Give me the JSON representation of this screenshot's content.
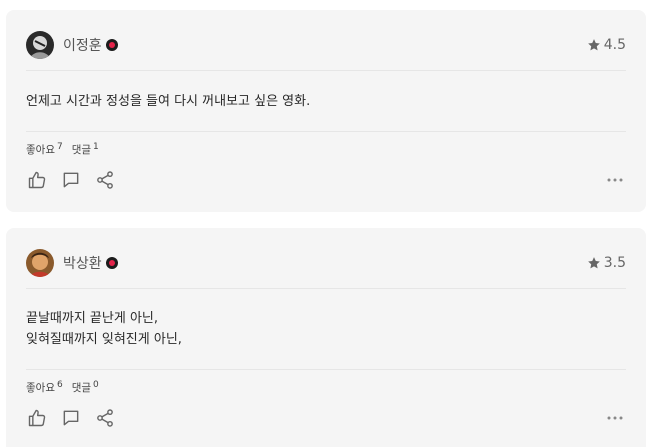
{
  "reviews": [
    {
      "author": "이정훈",
      "rating": "4.5",
      "text": "언제고 시간과 정성을 들여 다시 꺼내보고 싶은 영화.",
      "likes_label": "좋아요",
      "likes_count": "7",
      "comments_label": "댓글",
      "comments_count": "1"
    },
    {
      "author": "박상환",
      "rating": "3.5",
      "text": "끝날때까지 끝난게 아닌,\n잊혀질때까지 잊혀진게 아닌,",
      "likes_label": "좋아요",
      "likes_count": "6",
      "comments_label": "댓글",
      "comments_count": "0"
    }
  ],
  "colors": {
    "card_bg": "#f5f5f5",
    "badge_accent": "#e3234a",
    "icon": "#666666"
  },
  "icons": [
    "star-icon",
    "thumbs-up-icon",
    "comment-icon",
    "share-icon",
    "more-icon",
    "verified-badge-icon"
  ]
}
